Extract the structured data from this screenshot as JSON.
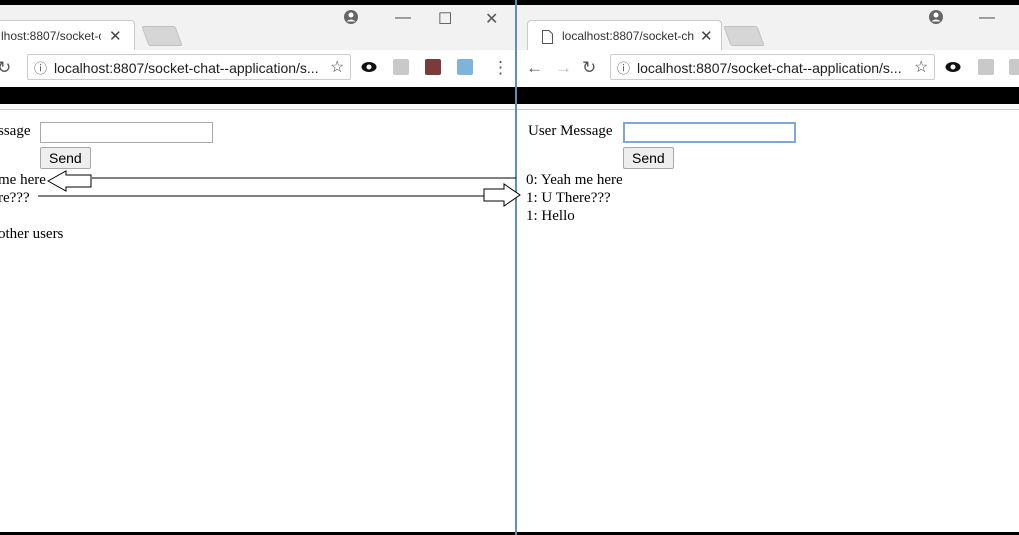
{
  "left": {
    "tab_title": "lhost:8807/socket-ch",
    "url": "localhost:8807/socket-chat--application/s...",
    "label": "ssage",
    "send_label": "Send",
    "messages": [
      "me here",
      "re???",
      "other users"
    ]
  },
  "right": {
    "tab_title": "localhost:8807/socket-ch",
    "url": "localhost:8807/socket-chat--application/s...",
    "label": "User Message",
    "send_label": "Send",
    "messages": [
      "0: Yeah me here",
      "1: U There???",
      "1: Hello"
    ]
  },
  "icons": {
    "close": "✕",
    "minimize": "—",
    "maximize": "☐",
    "account": "account-circle-icon",
    "star": "☆",
    "reload": "↻",
    "back": "←",
    "forward": "→",
    "menu": "⋮",
    "info": "ⓘ"
  },
  "colors": {
    "divider": "#5d8fb8",
    "focus": "#7ea7d6"
  }
}
